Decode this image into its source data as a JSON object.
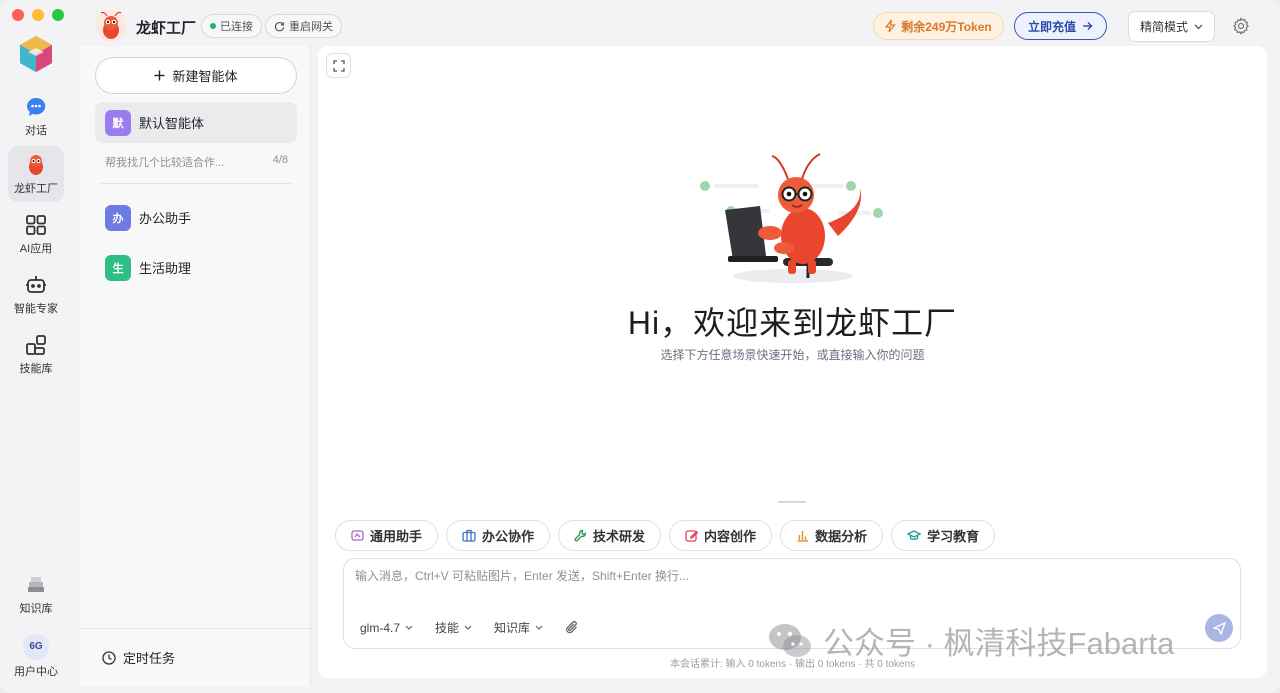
{
  "rail": {
    "items": [
      {
        "label": "对话"
      },
      {
        "label": "龙虾工厂"
      },
      {
        "label": "AI应用"
      },
      {
        "label": "智能专家"
      },
      {
        "label": "技能库"
      },
      {
        "label": "知识库"
      },
      {
        "label": "用户中心"
      }
    ],
    "avatar_text": "6G"
  },
  "header": {
    "title": "龙虾工厂",
    "status": "已连接",
    "restart": "重启网关",
    "token_remaining": "剩余249万Token",
    "recharge": "立即充值",
    "mode": "精简模式"
  },
  "agents": {
    "new_agent": "新建智能体",
    "default": {
      "badge": "默",
      "name": "默认智能体",
      "color": "#9b7cf0"
    },
    "preview": {
      "text": "帮我找几个比较适合作...",
      "count": "4/8"
    },
    "list": [
      {
        "badge": "办",
        "name": "办公助手",
        "color": "#6e7ae6"
      },
      {
        "badge": "生",
        "name": "生活助理",
        "color": "#2fbf86"
      }
    ],
    "scheduled": "定时任务"
  },
  "main": {
    "welcome_title": "Hi，欢迎来到龙虾工厂",
    "welcome_sub": "选择下方任意场景快速开始，或直接输入你的问题",
    "chips": [
      {
        "label": "通用助手",
        "icon": "palette-icon",
        "color": "#b05fcf"
      },
      {
        "label": "办公协作",
        "icon": "briefcase-icon",
        "color": "#3b6fd0"
      },
      {
        "label": "技术研发",
        "icon": "wrench-icon",
        "color": "#2e9a57"
      },
      {
        "label": "内容创作",
        "icon": "edit-icon",
        "color": "#e0445a"
      },
      {
        "label": "数据分析",
        "icon": "bar-chart-icon",
        "color": "#e08a2a"
      },
      {
        "label": "学习教育",
        "icon": "graduation-cap-icon",
        "color": "#1f9e9a"
      }
    ],
    "input_placeholder": "输入消息，Ctrl+V 可粘贴图片，Enter 发送，Shift+Enter 换行...",
    "model": "glm-4.7",
    "skills": "技能",
    "knowledge": "知识库",
    "token_stats": "本会话累计: 输入 0 tokens · 输出 0 tokens · 共 0 tokens"
  },
  "watermark": "公众号 · 枫清科技Fabarta"
}
